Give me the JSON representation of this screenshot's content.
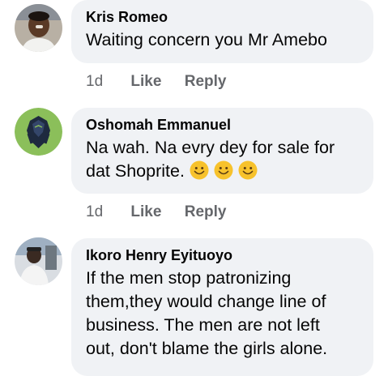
{
  "comments": [
    {
      "author": "Kris Romeo",
      "text": "Waiting concern you Mr Amebo",
      "time": "1d",
      "like_label": "Like",
      "reply_label": "Reply"
    },
    {
      "author": "Oshomah Emmanuel",
      "text": "Na wah. Na evry dey for sale for dat Shoprite.",
      "emoji_count": 3,
      "time": "1d",
      "like_label": "Like",
      "reply_label": "Reply"
    },
    {
      "author": "Ikoro Henry Eyituoyo",
      "text": "If the men stop patronizing them,they would change line of business. The men are not left out, don't blame the girls alone."
    }
  ],
  "colors": {
    "bubble": "#f0f2f5",
    "meta_text": "#65676b",
    "lion_badge": "#8bbf5a"
  }
}
